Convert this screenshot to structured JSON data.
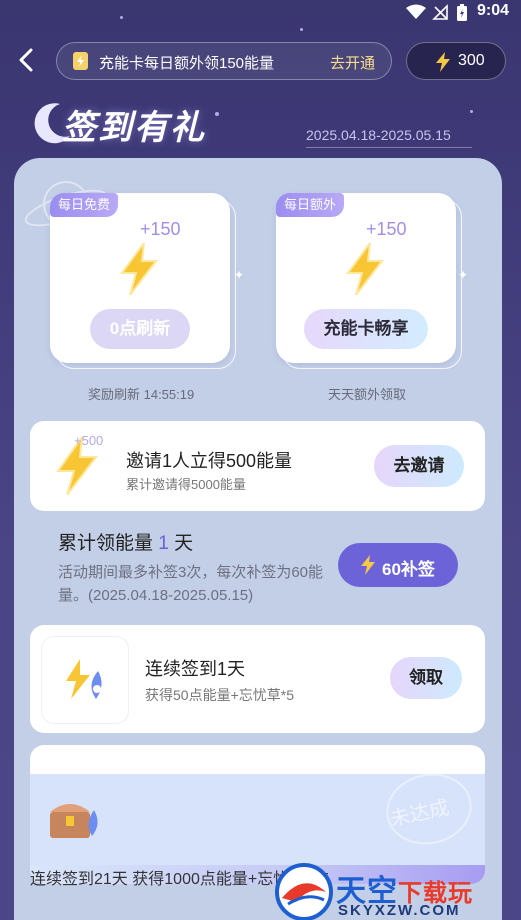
{
  "status_bar": {
    "time": "9:04"
  },
  "top_bar": {
    "banner_text": "充能卡每日额外领150能量",
    "banner_action": "去开通",
    "energy_value": "300"
  },
  "header": {
    "title": "签到有礼",
    "date_range": "2025.04.18-2025.05.15"
  },
  "reward_cards": [
    {
      "tag": "每日免费",
      "plus": "+150",
      "button": "0点刷新",
      "note": "奖励刷新 14:55:19"
    },
    {
      "tag": "每日额外",
      "plus": "+150",
      "button": "充能卡畅享",
      "note": "天天额外领取"
    }
  ],
  "invite": {
    "plus": "+500",
    "title": "邀请1人立得500能量",
    "subtitle": "累计邀请得5000能量",
    "button": "去邀请"
  },
  "cumulative": {
    "prefix": "累计领能量",
    "days": "1",
    "suffix": "天",
    "description": "活动期间最多补签3次，每次补签为60能量。(2025.04.18-2025.05.15)",
    "makeup_button": "60补签"
  },
  "streaks": [
    {
      "title": "连续签到1天",
      "subtitle": "获得50点能量+忘忧草*5",
      "button": "领取"
    },
    {
      "title": "连续签到21天",
      "subtitle": "获得1000点能量+忘忧草*15",
      "stamp": "未达成"
    }
  ],
  "watermark": {
    "title_a": "天空",
    "title_b": "下载玩",
    "url": "SKYXZW.COM"
  },
  "colors": {
    "background": "#3f3a78",
    "panel": "#c3cfe7",
    "accent": "#6c63d8",
    "gold": "#f6dd8a"
  }
}
